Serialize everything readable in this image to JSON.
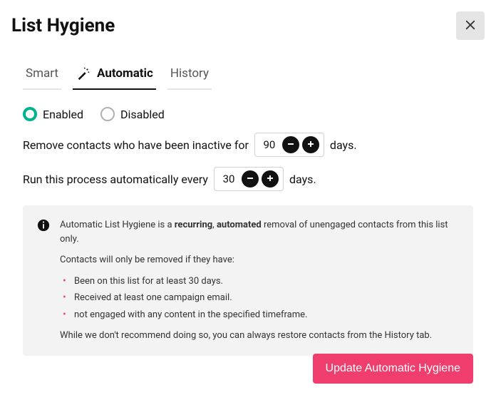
{
  "header": {
    "title": "List Hygiene"
  },
  "tabs": {
    "smart": "Smart",
    "automatic": "Automatic",
    "history": "History"
  },
  "radios": {
    "enabled": "Enabled",
    "disabled": "Disabled"
  },
  "controls": {
    "inactive_prefix": "Remove contacts who have been inactive for",
    "inactive_value": "90",
    "inactive_suffix": "days.",
    "run_prefix": "Run this process automatically every",
    "run_value": "30",
    "run_suffix": "days."
  },
  "info": {
    "line1_a": "Automatic List Hygiene is a ",
    "line1_b": "recurring",
    "line1_c": ", ",
    "line1_d": "automated",
    "line1_e": " removal of unengaged contacts from this list only.",
    "line2": "Contacts will only be removed if they have:",
    "bullet1": "Been on this list for at least 30 days.",
    "bullet2": "Received at least one campaign email.",
    "bullet3": "not engaged with any content in the specified timeframe.",
    "line3": "While we don't recommend doing so, you can always restore contacts from the History tab."
  },
  "footer": {
    "primary": "Update Automatic Hygiene"
  }
}
